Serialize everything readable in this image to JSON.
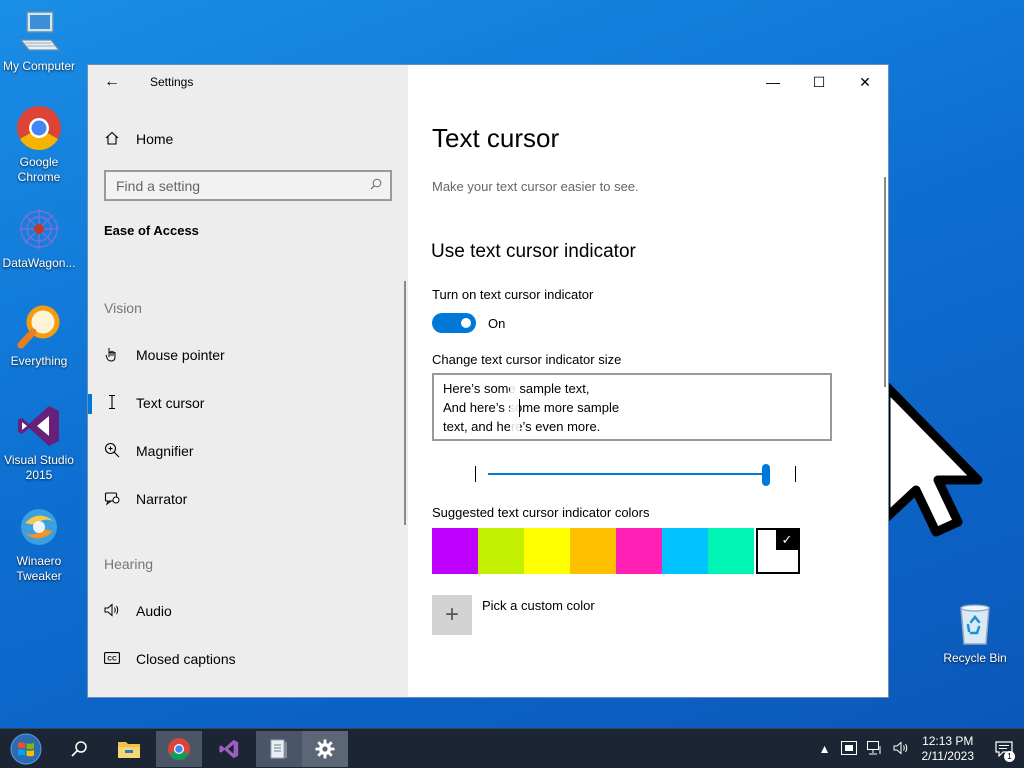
{
  "desktop": {
    "icons": [
      {
        "label": "My Computer"
      },
      {
        "label": "Google Chrome"
      },
      {
        "label": "DataWagon..."
      },
      {
        "label": "Everything"
      },
      {
        "label": "Visual Studio 2015"
      },
      {
        "label": "Winaero Tweaker"
      },
      {
        "label": "Recycle Bin"
      }
    ]
  },
  "window": {
    "app_title": "Settings",
    "back_icon": "back-arrow-icon",
    "controls": {
      "minimize": "—",
      "maximize": "☐",
      "close": "✕"
    }
  },
  "sidebar": {
    "home": "Home",
    "search_placeholder": "Find a setting",
    "section": "Ease of Access",
    "vision_header": "Vision",
    "vision_items": [
      {
        "label": "Mouse pointer",
        "icon": "mouse-pointer-icon"
      },
      {
        "label": "Text cursor",
        "icon": "text-cursor-icon",
        "selected": true
      },
      {
        "label": "Magnifier",
        "icon": "magnifier-icon"
      },
      {
        "label": "Narrator",
        "icon": "narrator-icon"
      }
    ],
    "hearing_header": "Hearing",
    "hearing_items": [
      {
        "label": "Audio",
        "icon": "audio-icon"
      },
      {
        "label": "Closed captions",
        "icon": "closed-captions-icon"
      }
    ]
  },
  "main": {
    "title": "Text cursor",
    "description": "Make your text cursor easier to see.",
    "subtitle": "Use text cursor indicator",
    "toggle_label": "Turn on text cursor indicator",
    "toggle_state": "On",
    "toggle_on": true,
    "size_label": "Change text cursor indicator size",
    "sample_lines": [
      "Here’s some sample text,",
      "And here’s some more sample",
      "text, and here’s even more."
    ],
    "slider_value_fraction": 0.99,
    "colors_label": "Suggested text cursor indicator colors",
    "colors": [
      "#bf00ff",
      "#c3f000",
      "#ffff00",
      "#ffc000",
      "#ff1fb4",
      "#00c3ff",
      "#00f5b4",
      "#ffffff"
    ],
    "selected_color_index": 7,
    "custom_color_label": "Pick a custom color"
  },
  "taskbar": {
    "apps": [
      "file-explorer-icon",
      "chrome-icon",
      "visual-studio-icon",
      "notepad-icon",
      "settings-icon"
    ],
    "time": "12:13 PM",
    "date": "2/11/2023",
    "notification_count": "1"
  }
}
